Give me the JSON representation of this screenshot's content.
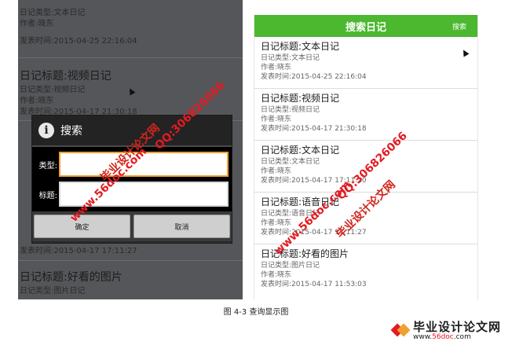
{
  "left": {
    "rows": [
      {
        "type_line": "日记类型:文本日记",
        "author": "作者:晓东",
        "time": "发表时间:2015-04-25 22:16:04"
      },
      {
        "title": "日记标题:视频日记",
        "type_line": "日记类型:视频日记",
        "author": "作者:晓东",
        "time": "发表时间:2015-04-17 21:30:18"
      }
    ],
    "row_after_dialog": {
      "time": "发表时间:2015-04-17 17:11:27"
    },
    "last_row": {
      "title": "日记标题:好看的图片",
      "type_line": "日记类型:图片日记"
    },
    "dialog": {
      "icon": "info-icon",
      "title": "搜索",
      "type_label": "类型:",
      "title_label": "标题:",
      "type_value": "",
      "title_value": "",
      "ok": "确定",
      "cancel": "取消"
    }
  },
  "right": {
    "appbar": {
      "title": "搜索日记",
      "action": "搜索",
      "color": "#4bb82f"
    },
    "rows": [
      {
        "title": "日记标题:文本日记",
        "type_line": "日记类型:文本日记",
        "author": "作者:晓东",
        "time": "发表时间:2015-04-25 22:16:04"
      },
      {
        "title": "日记标题:视频日记",
        "type_line": "日记类型:视频日记",
        "author": "作者:晓东",
        "time": "发表时间:2015-04-17 21:30:18"
      },
      {
        "title": "日记标题:文本日记",
        "type_line": "日记类型:文本日记",
        "author": "作者:晓东",
        "time": "发表时间:2015-04-17 17:11:20"
      },
      {
        "title": "日记标题:语音日记",
        "type_line": "日记类型:语音日记",
        "author": "作者:晓东",
        "time": "发表时间:2015-04-17 17:11:27"
      },
      {
        "title": "日记标题:好看的图片",
        "type_line": "日记类型:图片日记",
        "author": "作者:晓东",
        "time": "发表时间:2015-04-17 11:53:03"
      }
    ]
  },
  "caption": "图 4-3 查询显示图",
  "watermarks": {
    "url": "www.56doc.com",
    "site": "毕业设计论文网",
    "qq": "QQ:306826066"
  },
  "brand": {
    "name": "毕业设计论文网",
    "url_prefix": "www.",
    "url_highlight": "56doc",
    "url_suffix": ".com"
  }
}
